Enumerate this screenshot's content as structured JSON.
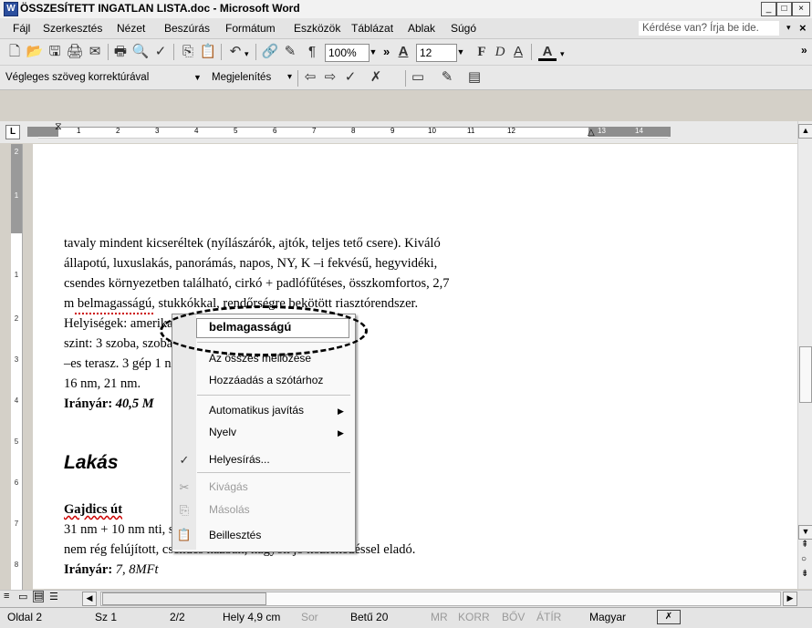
{
  "window": {
    "title": "ÖSSZESÍTETT INGATLAN LISTA.doc - Microsoft Word",
    "icon_label": "W",
    "buttons": [
      "_",
      "□",
      "×"
    ]
  },
  "menu": {
    "items": [
      "Fájl",
      "Szerkesztés",
      "Nézet",
      "Beszúrás",
      "Formátum",
      "Eszközök",
      "Táblázat",
      "Ablak",
      "Súgó"
    ],
    "help_placeholder": "Kérdése van? Írja be ide.",
    "help_close": "×"
  },
  "toolbar": {
    "zoom": "100%",
    "font_size": "12",
    "icons": [
      "new-document-icon",
      "open-folder-icon",
      "save-icon",
      "permission-icon",
      "email-icon",
      "print-icon",
      "print-preview-icon",
      "spelling-icon",
      "copy-icon",
      "paste-icon",
      "undo-icon",
      "hyperlink-icon",
      "tables-borders-icon",
      "show-formatting-icon",
      "styles-icon",
      "font-icon",
      "bold-icon",
      "italic-icon",
      "underline-icon",
      "font-color-icon"
    ],
    "glyphs": {
      "new": "🗋",
      "open": "📂",
      "save": "🖫",
      "perm": "🖨",
      "email": "✉",
      "print": "🖶",
      "preview": "🔍",
      "spell": "✓",
      "copy": "⎘",
      "paste": "📋",
      "undo": "↶",
      "link": "🔗",
      "draw": "✎",
      "pilcrow": "¶",
      "more": "»",
      "styleA": "A",
      "bold": "F",
      "italic": "D",
      "underline": "A",
      "fontcolor": "A"
    }
  },
  "reviewing": {
    "display": "Végleges szöveg korrektúrával",
    "show": "Megjelenítés",
    "show_arrow": "▾"
  },
  "ruler": {
    "corner": "L",
    "marks": [
      "1",
      "2",
      "3",
      "4",
      "5",
      "6",
      "7",
      "8",
      "9",
      "10",
      "11",
      "12",
      "13",
      "14"
    ],
    "vmarks": [
      "2",
      "1",
      "1",
      "2",
      "3",
      "4",
      "5",
      "6",
      "7",
      "8"
    ]
  },
  "document": {
    "lines": [
      "tavaly mindent kicseréltek (nyílászárók, ajtók, teljes tető csere). Kiváló",
      "állapotú, luxuslakás, panorámás, napos, NY, K –i fekvésű, hegyvidéki,",
      "csendes környezetben található, cirkó + padlófűtéses, összkomfortos, 2,7",
      "m belmagasságú, stukkókkal, rendőrségre bekötött riasztórendszer.",
      "Helyiségek: amerikai konyha, wc, felső",
      "szint: 3 szoba, szoba+wc, padlásrakodó, 15 nm",
      "–es terasz. 3 gép 1 nm). Szobák méretei: 37 nm,",
      "16 nm, 21 nm."
    ],
    "price1_label": "Irányár: ",
    "price1_value": "40,5 M",
    "heading": "Lakás",
    "street": "Gajdics út",
    "line_a": "31 nm + 10 nm nti, saját tulajdonú öröklakás,",
    "line_b": "nem rég felújított, csendes házban, nagyon jó közlekedéssel eladó.",
    "price2_label": "Irányár: ",
    "price2_value": "7, 8MFt"
  },
  "context_menu": {
    "suggestion": "belmagasságú",
    "ignore_all": "Az összes mellőzése",
    "add_dictionary": "Hozzáadás a szótárhoz",
    "autocorrect": "Automatikus javítás",
    "language": "Nyelv",
    "spelling": "Helyesírás...",
    "cut": "Kivágás",
    "copy": "Másolás",
    "paste": "Beillesztés",
    "submenu_arrow": "▶",
    "glyphs": {
      "spelling": "✓",
      "cut": "✂",
      "copy": "⎘",
      "paste": "📋"
    }
  },
  "status": {
    "page": "Oldal 2",
    "section": "Sz 1",
    "pages": "2/2",
    "position": "Hely 4,9 cm",
    "line": "Sor",
    "column": "Betű 20",
    "rec": "MR",
    "trk": "KORR",
    "ext": "BŐV",
    "ovr": "ÁTÍR",
    "language": "Magyar"
  }
}
